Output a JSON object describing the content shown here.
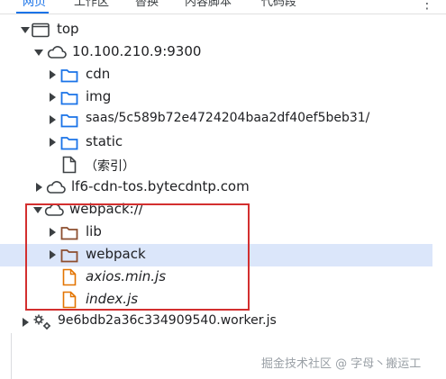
{
  "tabs": [
    {
      "label": "网页",
      "active": true
    },
    {
      "label": "工作区",
      "active": false
    },
    {
      "label": "替换",
      "active": false
    },
    {
      "label": "内容脚本",
      "active": false
    },
    {
      "label": "代码段",
      "active": false
    }
  ],
  "more_menu_glyph": "⋮",
  "tree": {
    "top": {
      "label": "top",
      "icon": "frame-icon",
      "expanded": true
    },
    "origin1": {
      "label": "10.100.210.9:9300",
      "icon": "cloud-icon",
      "expanded": true
    },
    "folders": [
      {
        "label": "cdn",
        "icon": "folder-icon"
      },
      {
        "label": "img",
        "icon": "folder-icon"
      },
      {
        "label": "saas/5c589b72e4724204baa2df40ef5beb31/",
        "icon": "folder-icon"
      },
      {
        "label": "static",
        "icon": "folder-icon"
      }
    ],
    "index_file": {
      "label": "（索引）",
      "icon": "file-icon"
    },
    "origin2": {
      "label": "lf6-cdn-tos.bytecdntp.com",
      "icon": "cloud-icon",
      "expanded": false
    },
    "webpack": {
      "label": "webpack://",
      "icon": "cloud-icon",
      "expanded": true
    },
    "webpack_children": [
      {
        "label": "lib",
        "icon": "folder-icon",
        "selected": false
      },
      {
        "label": "webpack",
        "icon": "folder-icon",
        "selected": true
      }
    ],
    "webpack_files": [
      {
        "label": "axios.min.js",
        "icon": "js-file-icon"
      },
      {
        "label": "index.js",
        "icon": "js-file-icon"
      }
    ],
    "worker": {
      "label": "9e6bdb2a36c334909540.worker.js",
      "icon": "gears-icon",
      "expanded": false
    }
  },
  "colors": {
    "accent": "#1a73e8",
    "folder_blue": "#1a73e8",
    "folder_brown": "#8d4e2f",
    "js_file_orange": "#e37400",
    "selection": "#dbe6fa",
    "highlight_border": "#d32f2f"
  },
  "watermark": "掘金技术社区 @ 字母丶搬运工"
}
